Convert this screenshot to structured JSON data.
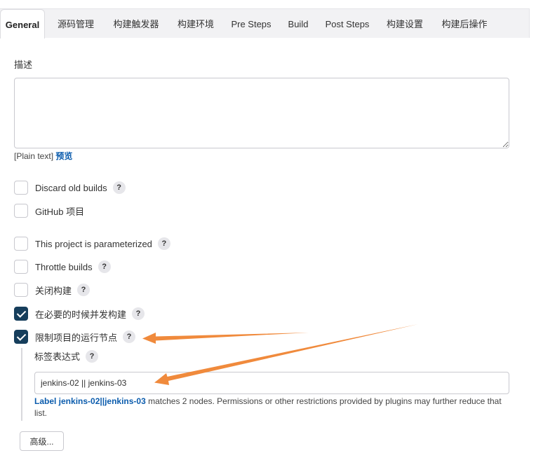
{
  "tabs": [
    {
      "label": "General",
      "active": true
    },
    {
      "label": "源码管理"
    },
    {
      "label": "构建触发器"
    },
    {
      "label": "构建环境"
    },
    {
      "label": "Pre Steps"
    },
    {
      "label": "Build"
    },
    {
      "label": "Post Steps"
    },
    {
      "label": "构建设置"
    },
    {
      "label": "构建后操作"
    }
  ],
  "description": {
    "label": "描述",
    "value": "",
    "plain_text": "[Plain text]",
    "preview_link": "预览"
  },
  "options": [
    {
      "label": "Discard old builds",
      "checked": false,
      "help": "?"
    },
    {
      "label": "GitHub 项目",
      "checked": false
    },
    {
      "label": "This project is parameterized",
      "checked": false,
      "help": "?"
    },
    {
      "label": "Throttle builds",
      "checked": false,
      "help": "?"
    },
    {
      "label": "关闭构建",
      "checked": false,
      "help": "?"
    },
    {
      "label": "在必要的时候并发构建",
      "checked": true,
      "help": "?"
    },
    {
      "label": "限制项目的运行节点",
      "checked": true,
      "help": "?"
    }
  ],
  "label_expression": {
    "label": "标签表达式",
    "help": "?",
    "value": "jenkins-02 || jenkins-03",
    "match_link": "Label jenkins-02||jenkins-03",
    "match_text": " matches 2 nodes. Permissions or other restrictions provided by plugins may further reduce that list."
  },
  "advanced_button": "高级...",
  "colors": {
    "accent": "#163e5c",
    "link": "#0b5cad",
    "annotation_arrow": "#f08a3c"
  }
}
